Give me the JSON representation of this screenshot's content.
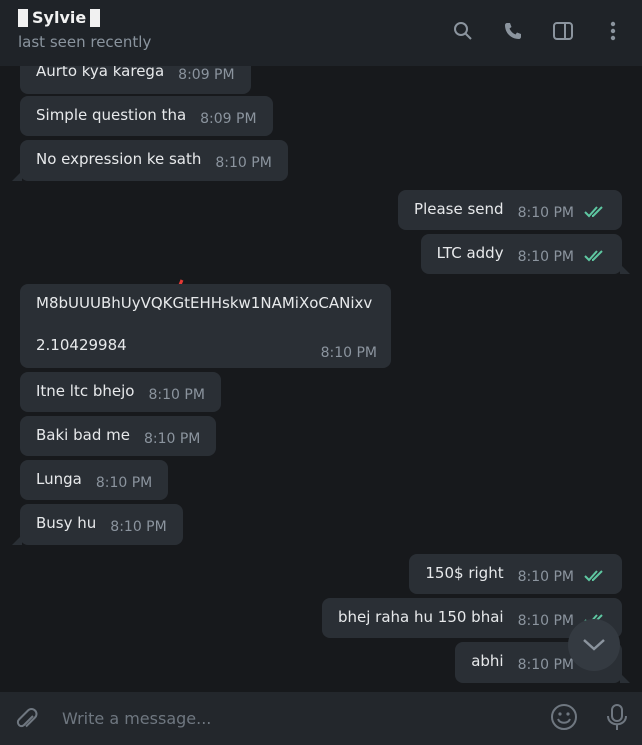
{
  "header": {
    "title": "Sylvie",
    "subtitle": "last seen recently",
    "icons": [
      "search-icon",
      "phone-icon",
      "sidebar-toggle-icon",
      "more-vertical-icon"
    ]
  },
  "messages": [
    {
      "dir": "in",
      "text": "Aurto kya karega",
      "time": "8:09 PM"
    },
    {
      "dir": "in",
      "text": "Simple question tha",
      "time": "8:09 PM"
    },
    {
      "dir": "in",
      "text": "No expression ke sath",
      "time": "8:10 PM"
    },
    {
      "dir": "out",
      "text": "Please send",
      "time": "8:10 PM",
      "read": true
    },
    {
      "dir": "out",
      "text": "LTC addy",
      "time": "8:10 PM",
      "read": true
    },
    {
      "dir": "in",
      "text": "M8bUUUBhUyVQKGtEHHskw1NAMiXoCANixv",
      "text2": "2.10429984",
      "time": "8:10 PM"
    },
    {
      "dir": "in",
      "text": "Itne ltc bhejo",
      "time": "8:10 PM"
    },
    {
      "dir": "in",
      "text": "Baki bad me",
      "time": "8:10 PM"
    },
    {
      "dir": "in",
      "text": "Lunga",
      "time": "8:10 PM"
    },
    {
      "dir": "in",
      "text": "Busy hu",
      "time": "8:10 PM"
    },
    {
      "dir": "out",
      "text": "150$ right",
      "time": "8:10 PM",
      "read": true
    },
    {
      "dir": "out",
      "text": "bhej raha hu 150 bhai",
      "time": "8:10 PM",
      "read": true
    },
    {
      "dir": "out",
      "text": "abhi",
      "time": "8:10 PM",
      "read": true
    }
  ],
  "composer": {
    "placeholder": "Write a message...",
    "icons": [
      "attach-icon",
      "emoji-icon",
      "microphone-icon"
    ]
  },
  "colors": {
    "accent": "#5ec7a1",
    "annotation": "#e53935"
  }
}
